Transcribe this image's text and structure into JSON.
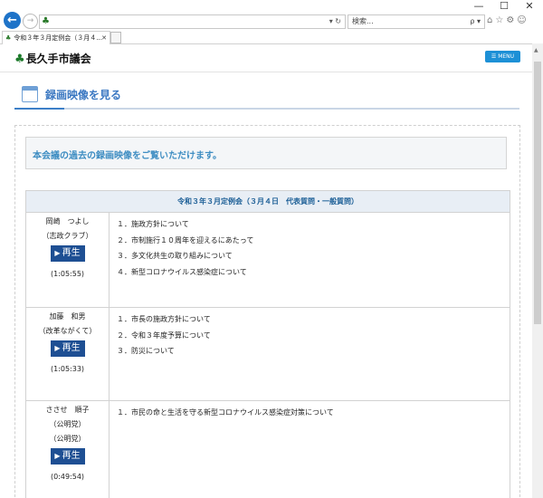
{
  "browser": {
    "window_controls": [
      "—",
      "☐",
      "✕"
    ],
    "address_ctrl": "▾ ↻",
    "search_placeholder": "検索...",
    "search_icon": "ρ ▾",
    "tool_icons": "⌂☆⚙☺",
    "tab_title": "令和３年３月定例会（３月４...",
    "tab_close": "✕"
  },
  "site": {
    "logo_text": "長久手市議会",
    "menu_label": "MENU",
    "page_title": "録画映像を見る",
    "intro_text": "本会議の過去の録画映像をご覧いただけます。"
  },
  "table": {
    "header": "令和３年３月定例会（３月４日　代表質問・一般質問）",
    "play_label": "再生",
    "rows": [
      {
        "name": "岡崎　つよし",
        "groups": [
          "（志政クラブ）"
        ],
        "duration": "(1:05:55)",
        "topics": [
          "１．施政方針について",
          "２．市制施行１０周年を迎えるにあたって",
          "３．多文化共生の取り組みについて",
          "４．新型コロナウイルス感染症について"
        ]
      },
      {
        "name": "加藤　和男",
        "groups": [
          "（改革ながくて）"
        ],
        "duration": "(1:05:33)",
        "topics": [
          "１．市長の施政方針について",
          "２．令和３年度予算について",
          "３．防災について"
        ]
      },
      {
        "name": "ささせ　順子",
        "groups": [
          "（公明党）",
          "（公明党）"
        ],
        "duration": "(0:49:54)",
        "topics": [
          "１．市民の命と生活を守る新型コロナウイルス感染症対策について"
        ]
      }
    ]
  }
}
